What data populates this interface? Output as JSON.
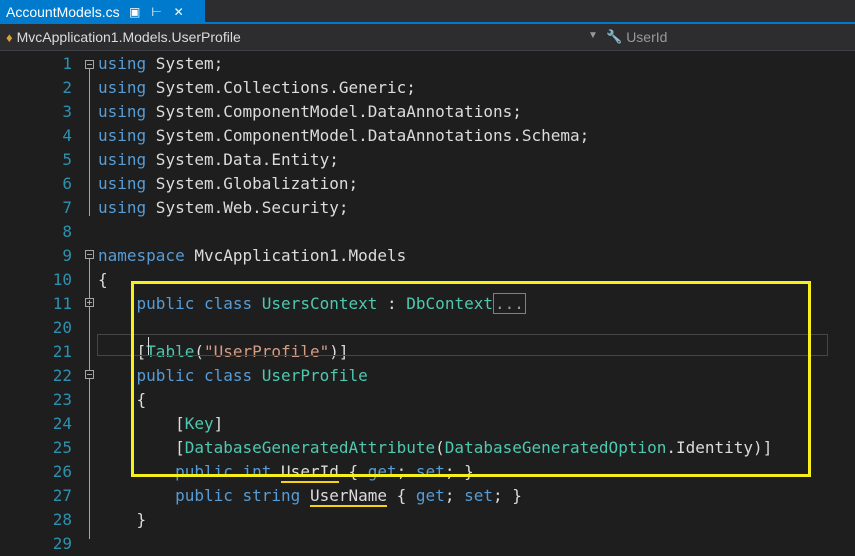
{
  "tab": {
    "filename": "AccountModels.cs",
    "lock_icon": "lock-icon",
    "pin_icon": "pin-icon",
    "close_icon": "close-icon"
  },
  "navigation": {
    "type_context": "MvcApplication1.Models.UserProfile",
    "member_context": "UserId"
  },
  "code_lines": [
    {
      "ln": "1",
      "segments": [
        {
          "c": "kw",
          "t": "using"
        },
        {
          "c": "",
          "t": " System;"
        }
      ]
    },
    {
      "ln": "2",
      "segments": [
        {
          "c": "kw",
          "t": "using"
        },
        {
          "c": "",
          "t": " System.Collections.Generic;"
        }
      ]
    },
    {
      "ln": "3",
      "segments": [
        {
          "c": "kw",
          "t": "using"
        },
        {
          "c": "",
          "t": " System.ComponentModel.DataAnnotations;"
        }
      ]
    },
    {
      "ln": "4",
      "segments": [
        {
          "c": "kw",
          "t": "using"
        },
        {
          "c": "",
          "t": " System.ComponentModel.DataAnnotations.Schema;"
        }
      ]
    },
    {
      "ln": "5",
      "segments": [
        {
          "c": "kw",
          "t": "using"
        },
        {
          "c": "",
          "t": " System.Data.Entity;"
        }
      ]
    },
    {
      "ln": "6",
      "segments": [
        {
          "c": "kw",
          "t": "using"
        },
        {
          "c": "",
          "t": " System.Globalization;"
        }
      ]
    },
    {
      "ln": "7",
      "segments": [
        {
          "c": "kw",
          "t": "using"
        },
        {
          "c": "",
          "t": " System.Web.Security;"
        }
      ]
    },
    {
      "ln": "8",
      "segments": []
    },
    {
      "ln": "9",
      "segments": [
        {
          "c": "kw",
          "t": "namespace"
        },
        {
          "c": "",
          "t": " MvcApplication1.Models"
        }
      ]
    },
    {
      "ln": "10",
      "segments": [
        {
          "c": "",
          "t": "{"
        }
      ]
    },
    {
      "ln": "11",
      "segments": [
        {
          "c": "",
          "t": "    "
        },
        {
          "c": "kw",
          "t": "public"
        },
        {
          "c": "",
          "t": " "
        },
        {
          "c": "kw",
          "t": "class"
        },
        {
          "c": "",
          "t": " "
        },
        {
          "c": "ty",
          "t": "UsersContext"
        },
        {
          "c": "",
          "t": " : "
        },
        {
          "c": "ty",
          "t": "DbContext"
        },
        {
          "c": "collapsed",
          "t": "..."
        }
      ]
    },
    {
      "ln": "20",
      "segments": []
    },
    {
      "ln": "21",
      "segments": [
        {
          "c": "",
          "t": "    ["
        },
        {
          "c": "ty",
          "t": "Table"
        },
        {
          "c": "",
          "t": "("
        },
        {
          "c": "st",
          "t": "\"UserProfile\""
        },
        {
          "c": "",
          "t": ")]"
        }
      ]
    },
    {
      "ln": "22",
      "segments": [
        {
          "c": "",
          "t": "    "
        },
        {
          "c": "kw",
          "t": "public"
        },
        {
          "c": "",
          "t": " "
        },
        {
          "c": "kw",
          "t": "class"
        },
        {
          "c": "",
          "t": " "
        },
        {
          "c": "ty",
          "t": "UserProfile"
        }
      ]
    },
    {
      "ln": "23",
      "segments": [
        {
          "c": "",
          "t": "    {"
        }
      ]
    },
    {
      "ln": "24",
      "segments": [
        {
          "c": "",
          "t": "        ["
        },
        {
          "c": "ty",
          "t": "Key"
        },
        {
          "c": "",
          "t": "]"
        }
      ]
    },
    {
      "ln": "25",
      "segments": [
        {
          "c": "",
          "t": "        ["
        },
        {
          "c": "ty",
          "t": "DatabaseGeneratedAttribute"
        },
        {
          "c": "",
          "t": "("
        },
        {
          "c": "ty",
          "t": "DatabaseGeneratedOption"
        },
        {
          "c": "",
          "t": ".Identity)]"
        }
      ]
    },
    {
      "ln": "26",
      "segments": [
        {
          "c": "",
          "t": "        "
        },
        {
          "c": "kw",
          "t": "public"
        },
        {
          "c": "",
          "t": " "
        },
        {
          "c": "kw",
          "t": "int"
        },
        {
          "c": "",
          "t": " "
        },
        {
          "c": "ul",
          "t": "UserId"
        },
        {
          "c": "",
          "t": " { "
        },
        {
          "c": "kw",
          "t": "get"
        },
        {
          "c": "",
          "t": "; "
        },
        {
          "c": "kw",
          "t": "set"
        },
        {
          "c": "",
          "t": "; }"
        }
      ]
    },
    {
      "ln": "27",
      "segments": [
        {
          "c": "",
          "t": "        "
        },
        {
          "c": "kw",
          "t": "public"
        },
        {
          "c": "",
          "t": " "
        },
        {
          "c": "kw",
          "t": "string"
        },
        {
          "c": "",
          "t": " "
        },
        {
          "c": "ul",
          "t": "UserName"
        },
        {
          "c": "",
          "t": " { "
        },
        {
          "c": "kw",
          "t": "get"
        },
        {
          "c": "",
          "t": "; "
        },
        {
          "c": "kw",
          "t": "set"
        },
        {
          "c": "",
          "t": "; }"
        }
      ]
    },
    {
      "ln": "28",
      "segments": [
        {
          "c": "",
          "t": "    }"
        }
      ]
    },
    {
      "ln": "29",
      "segments": []
    }
  ],
  "colors": {
    "keyword": "#569cd6",
    "type": "#4ec9b0",
    "string": "#d69d85",
    "line_number": "#2b91af",
    "highlight_box": "#f5f01c",
    "tab_active": "#007acc"
  }
}
